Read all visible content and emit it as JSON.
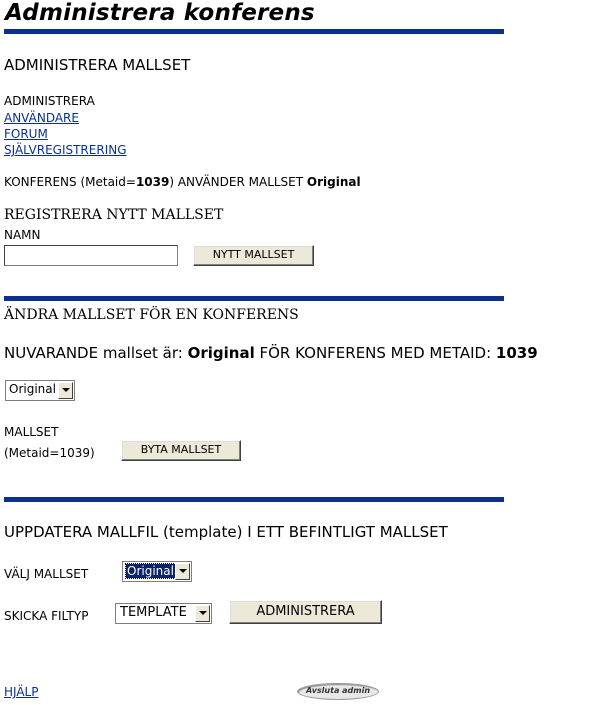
{
  "page": {
    "title": "Administrera konferens"
  },
  "section1": {
    "heading": "ADMINISTRERA MALLSET",
    "admin_label": "ADMINISTRERA",
    "links": [
      "ANVÄNDARE",
      "FORUM",
      "SJÄLVREGISTRERING"
    ],
    "conf_pre": "KONFERENS (Metaid=",
    "metaid": "1039",
    "conf_mid": ") ANVÄNDER MALLSET ",
    "mallset": "Original"
  },
  "register": {
    "heading": "REGISTRERA NYTT MALLSET",
    "name_label": "NAMN",
    "name_value": "",
    "button": "NYTT MALLSET"
  },
  "change": {
    "heading": "ÄNDRA MALLSET FÖR EN KONFERENS",
    "current_pre": "NUVARANDE mallset är: ",
    "current_mallset": "Original",
    "current_mid": " FÖR KONFERENS MED METAID: ",
    "current_metaid": "1039",
    "select_value": "Original",
    "mallset_label": "MALLSET",
    "metaid_label": "(Metaid=1039)",
    "button": "BYTA MALLSET"
  },
  "update": {
    "heading": "UPPDATERA MALLFIL (template) I ETT BEFINTLIGT MALLSET",
    "choose_label": "VÄLJ MALLSET",
    "choose_value": "Original",
    "filetype_label": "SKICKA FILTYP",
    "filetype_value": "TEMPLATE",
    "button": "ADMINISTRERA"
  },
  "footer": {
    "help": "HJÄLP",
    "logout": "Avsluta admin"
  },
  "colors": {
    "bar": "#0a2f8f",
    "link": "#0b2f9a",
    "selection": "#0a246a"
  }
}
